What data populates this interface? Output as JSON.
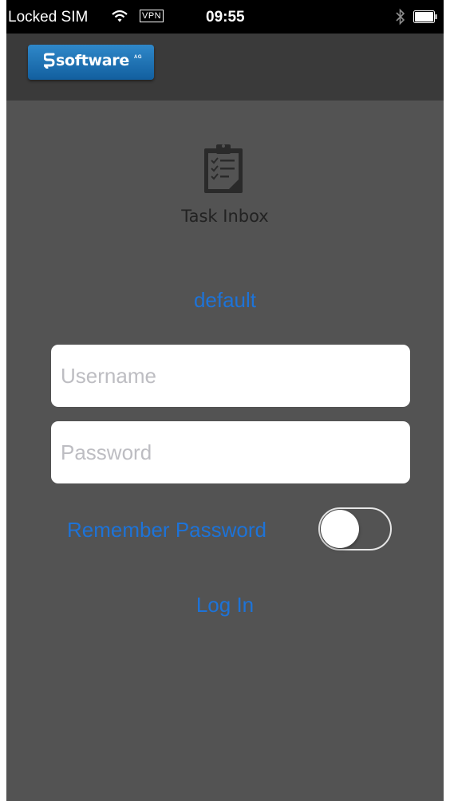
{
  "status_bar": {
    "carrier": "Locked SIM",
    "vpn": "VPN",
    "time": "09:55",
    "icons": [
      "wifi-icon",
      "bluetooth-icon",
      "battery-icon"
    ]
  },
  "nav_bar": {
    "logo_text": "software",
    "logo_sup": "AG"
  },
  "app": {
    "icon": "clipboard-checklist-icon",
    "title": "Task Inbox"
  },
  "login": {
    "server_name": "default",
    "username_placeholder": "Username",
    "password_placeholder": "Password",
    "remember_label": "Remember Password",
    "remember_checked": false,
    "login_label": "Log In"
  },
  "colors": {
    "background": "#535353",
    "nav_bar": "#3a3a3a",
    "accent": "#1d73d8",
    "logo": "#1f6fb2"
  }
}
